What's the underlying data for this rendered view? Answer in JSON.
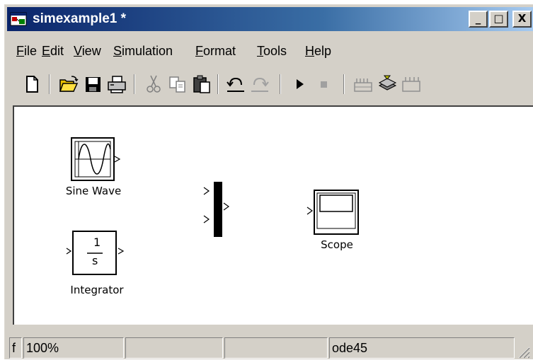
{
  "window": {
    "title": "simexample1 *"
  },
  "caption_buttons": {
    "minimize": "_",
    "maximize": "□",
    "close": "X"
  },
  "menu": {
    "items": [
      "File",
      "Edit",
      "View",
      "Simulation",
      "Format",
      "Tools",
      "Help"
    ]
  },
  "toolbar": {
    "buttons": [
      "new-icon",
      "open-icon",
      "save-icon",
      "print-icon",
      "cut-icon",
      "copy-icon",
      "paste-icon",
      "undo-icon",
      "redo-icon",
      "start-icon",
      "stop-icon",
      "library-browser-icon",
      "build-icon",
      "refresh-icon"
    ]
  },
  "blocks": {
    "sine_wave": {
      "label": "Sine Wave"
    },
    "integrator": {
      "label": "Integrator",
      "numerator": "1",
      "denominator": "s"
    },
    "mux": {
      "label": ""
    },
    "scope": {
      "label": "Scope"
    }
  },
  "status": {
    "pane1": "f",
    "zoom": "100%",
    "pane3": "",
    "pane4": "",
    "solver": "ode45"
  },
  "colors": {
    "title_start": "#0a246a",
    "title_end": "#a6caf0",
    "chrome": "#d4d0c8",
    "canvas": "#ffffff"
  }
}
